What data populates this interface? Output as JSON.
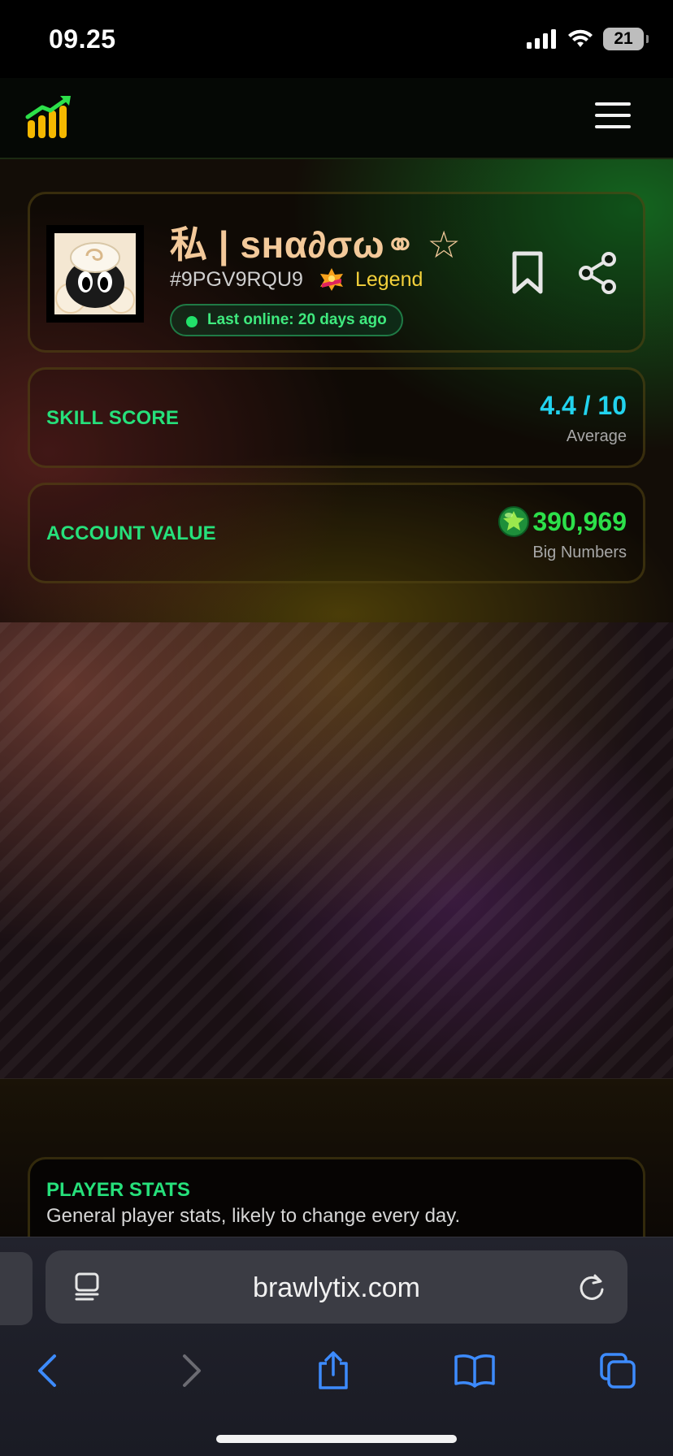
{
  "status_bar": {
    "time": "09.25",
    "battery": "21"
  },
  "nav": {
    "logo_icon": "chart-bars-arrow-icon",
    "menu_icon": "hamburger-menu-icon"
  },
  "profile": {
    "name": "私 | ѕнα∂σω⚭ ☆",
    "tag": "#9PGV9RQU9",
    "rank": "Legend",
    "last_online": "Last online: 20 days ago",
    "avatar_icon": "sheep-avatar-icon"
  },
  "skill": {
    "label": "SKILL SCORE",
    "value": "4.4 / 10",
    "sub": "Average"
  },
  "account": {
    "label": "ACCOUNT VALUE",
    "value": "390,969",
    "sub": "Big Numbers",
    "icon": "gem-icon"
  },
  "player_stats": {
    "title": "PLAYER STATS",
    "subtitle": "General player stats, likely to change every day."
  },
  "browser": {
    "url": "brawlytix.com"
  },
  "colors": {
    "accent_green": "#26e07b",
    "skill_cyan": "#22d3ee",
    "value_green": "#2ce04a",
    "rank_yellow": "#f4d13b",
    "name_peach": "#f3c99a",
    "ios_blue": "#3d8bfd"
  }
}
